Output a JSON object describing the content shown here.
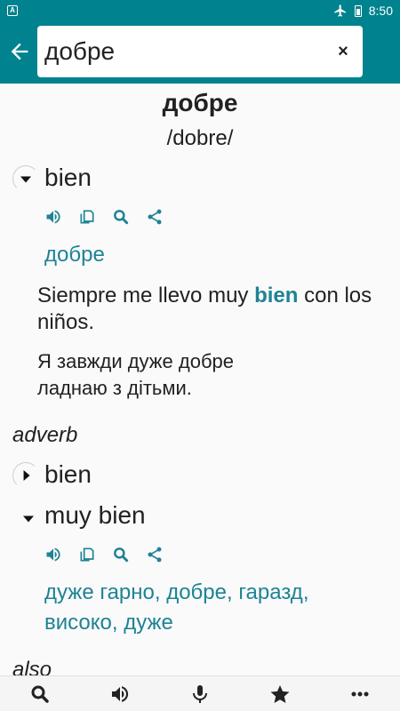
{
  "status_bar": {
    "left_icon": "A",
    "right_icons": [
      "airplane-icon",
      "battery-icon"
    ],
    "time": "8:50"
  },
  "search": {
    "value": "добре"
  },
  "entry": {
    "headword": "добре",
    "pronunciation": "/dobre/",
    "sense1": {
      "word": "bien",
      "translation": "добре",
      "example_before": "Siempre me llevo muy ",
      "example_highlight": "bien",
      "example_after": " con los niños.",
      "example_translation": "Я завжди дуже добре ладнаю з дітьми."
    },
    "part_of_speech": "adverb",
    "sense2": {
      "word": "bien"
    },
    "sense3": {
      "word": "muy bien",
      "translation": "дуже гарно, добре, гаразд, високо, дуже"
    },
    "also_label": "also"
  },
  "colors": {
    "primary": "#00838f",
    "accent_text": "#1e8395"
  },
  "bottom_nav": [
    "search-icon",
    "speaker-icon",
    "microphone-icon",
    "star-icon",
    "more-icon"
  ]
}
